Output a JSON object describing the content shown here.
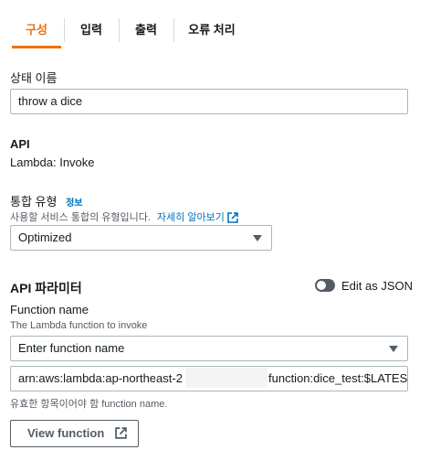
{
  "tabs": [
    {
      "label": "구성",
      "active": true
    },
    {
      "label": "입력",
      "active": false
    },
    {
      "label": "출력",
      "active": false
    },
    {
      "label": "오류 처리",
      "active": false
    }
  ],
  "state_name": {
    "label": "상태 이름",
    "value": "throw a dice"
  },
  "api": {
    "label": "API",
    "value": "Lambda: Invoke"
  },
  "integration": {
    "label": "통합 유형",
    "info_link": "정보",
    "description": "사용할 서비스 통합의 유형입니다.",
    "learn_more": "자세히 알아보기",
    "selected": "Optimized"
  },
  "params": {
    "heading": "API 파라미터",
    "toggle_label": "Edit as JSON",
    "function_name_label": "Function name",
    "function_name_desc": "The Lambda function to invoke",
    "function_select_placeholder": "Enter function name",
    "arn_prefix": "arn:aws:lambda:ap-northeast-2",
    "arn_suffix": "function:dice_test:$LATES",
    "hint": "유효한 항목이어야 함 function name.",
    "view_button": "View function"
  },
  "colors": {
    "accent": "#ec7211",
    "link": "#0073bb",
    "toggle": "#545b64"
  }
}
